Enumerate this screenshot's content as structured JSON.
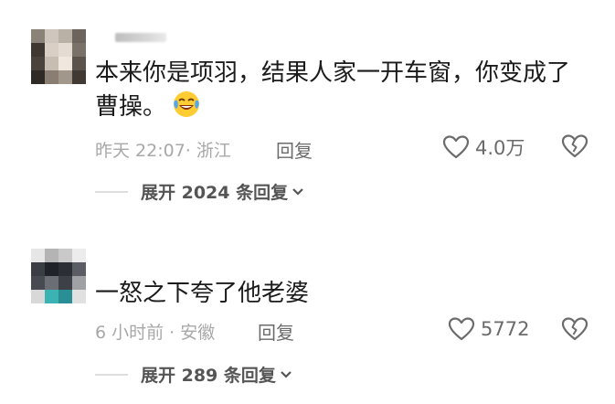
{
  "comments": [
    {
      "text_line1": "本来你是项羽，结果人家一开车窗，你变成了",
      "text_line2": "曹操。",
      "emoji": "laughing-crying-emoji",
      "time_location": "昨天 22:07· 浙江",
      "reply_label": "回复",
      "like_count": "4.0万",
      "expand_label": "展开 2024 条回复"
    },
    {
      "text_line1": "一怒之下夸了他老婆",
      "time_location": "6 小时前 · 安徽",
      "reply_label": "回复",
      "like_count": "5772",
      "expand_label": "展开 289 条回复"
    }
  ],
  "colors": {
    "text": "#1b1b1b",
    "meta": "#a8a8a8",
    "action": "#6b6b6b",
    "divider": "#dedede"
  },
  "icons": [
    "heart-outline-icon",
    "broken-heart-icon",
    "chevron-down-icon"
  ]
}
